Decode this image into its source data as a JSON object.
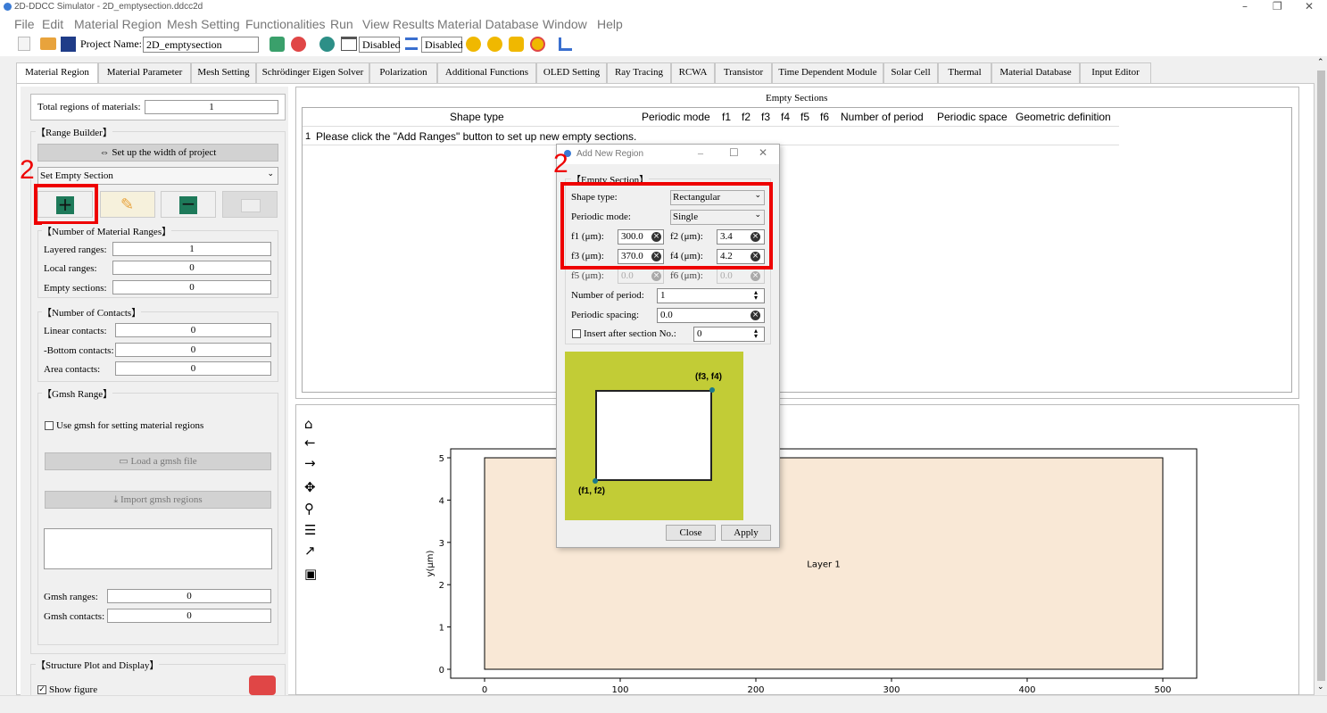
{
  "window": {
    "title": "2D-DDCC Simulator - 2D_emptysection.ddcc2d",
    "min": "–",
    "max": "❐",
    "close": "✕"
  },
  "menu": [
    "File",
    "Edit",
    "Material Region",
    "Mesh Setting",
    "Functionalities",
    "Run",
    "View Results",
    "Material Database",
    "Window",
    "Help"
  ],
  "toolbar": {
    "project_label": "Project Name:",
    "project_name": "2D_emptysection",
    "disabled1": "Disabled",
    "disabled2": "Disabled"
  },
  "tabs": [
    "Material Region",
    "Material Parameter",
    "Mesh Setting",
    "Schrödinger Eigen Solver",
    "Polarization",
    "Additional Functions",
    "OLED Setting",
    "Ray Tracing",
    "RCWA",
    "Transistor",
    "Time Dependent Module",
    "Solar Cell",
    "Thermal",
    "Material Database",
    "Input Editor"
  ],
  "left": {
    "total_label": "Total regions of materials:",
    "total_value": "1",
    "range_builder": "【Range Builder】",
    "setup_width": "Set up the width of project",
    "set_empty": "Set Empty Section",
    "num_ranges": "【Number of Material Ranges】",
    "layered_label": "Layered ranges:",
    "layered": "1",
    "local_label": "Local ranges:",
    "local": "0",
    "empty_label": "Empty sections:",
    "empty": "0",
    "num_contacts": "【Number of Contacts】",
    "linear_label": "Linear contacts:",
    "linear": "0",
    "bottom_label": "-Bottom contacts:",
    "bottom": "0",
    "area_label": "Area contacts:",
    "area": "0",
    "gmsh_range": "【Gmsh Range】",
    "use_gmsh": "Use gmsh for setting material regions",
    "load_gmsh": "Load a gmsh file",
    "import_gmsh": "Import gmsh regions",
    "gmsh_ranges_label": "Gmsh ranges:",
    "gmsh_ranges": "0",
    "gmsh_contacts_label": "Gmsh contacts:",
    "gmsh_contacts": "0",
    "structure": "【Structure Plot and Display】",
    "show_figure": "Show figure"
  },
  "annotations": {
    "step_left": "2",
    "step_dialog": "2"
  },
  "table": {
    "title": "Empty Sections",
    "headers": [
      "Shape type",
      "Periodic mode",
      "f1",
      "f2",
      "f3",
      "f4",
      "f5",
      "f6",
      "Number of period",
      "Periodic space",
      "Geometric definition"
    ],
    "row_num": "1",
    "row_text": "Please click the \"Add Ranges\" button to set up new empty sections."
  },
  "dialog": {
    "title": "Add New Region",
    "section": "【Empty Section】",
    "shape_label": "Shape type:",
    "shape": "Rectangular",
    "periodic_label": "Periodic mode:",
    "periodic": "Single",
    "f1_label": "f1 (μm):",
    "f1": "300.0",
    "f2_label": "f2 (μm):",
    "f2": "3.4",
    "f3_label": "f3 (μm):",
    "f3": "370.0",
    "f4_label": "f4 (μm):",
    "f4": "4.2",
    "f5_label": "f5 (μm):",
    "f5": "0.0",
    "f6_label": "f6 (μm):",
    "f6": "0.0",
    "nperiod_label": "Number of period:",
    "nperiod": "1",
    "spacing_label": "Periodic spacing:",
    "spacing": "0.0",
    "insert_label": "Insert after section No.:",
    "insert": "0",
    "pt1": "(f1, f2)",
    "pt2": "(f3, f4)",
    "close": "Close",
    "apply": "Apply"
  },
  "chart_data": {
    "type": "area",
    "ylabel": "y(μm)",
    "xlabel": "",
    "xticks": [
      "0",
      "100",
      "200",
      "300",
      "400",
      "500"
    ],
    "yticks": [
      "0",
      "1",
      "2",
      "3",
      "4",
      "5"
    ],
    "xlim": [
      0,
      500
    ],
    "ylim": [
      0,
      5
    ],
    "layers": [
      {
        "name": "Layer 1",
        "x": [
          0,
          500
        ],
        "y": [
          0,
          5
        ],
        "color": "#f9e8d6"
      }
    ]
  }
}
